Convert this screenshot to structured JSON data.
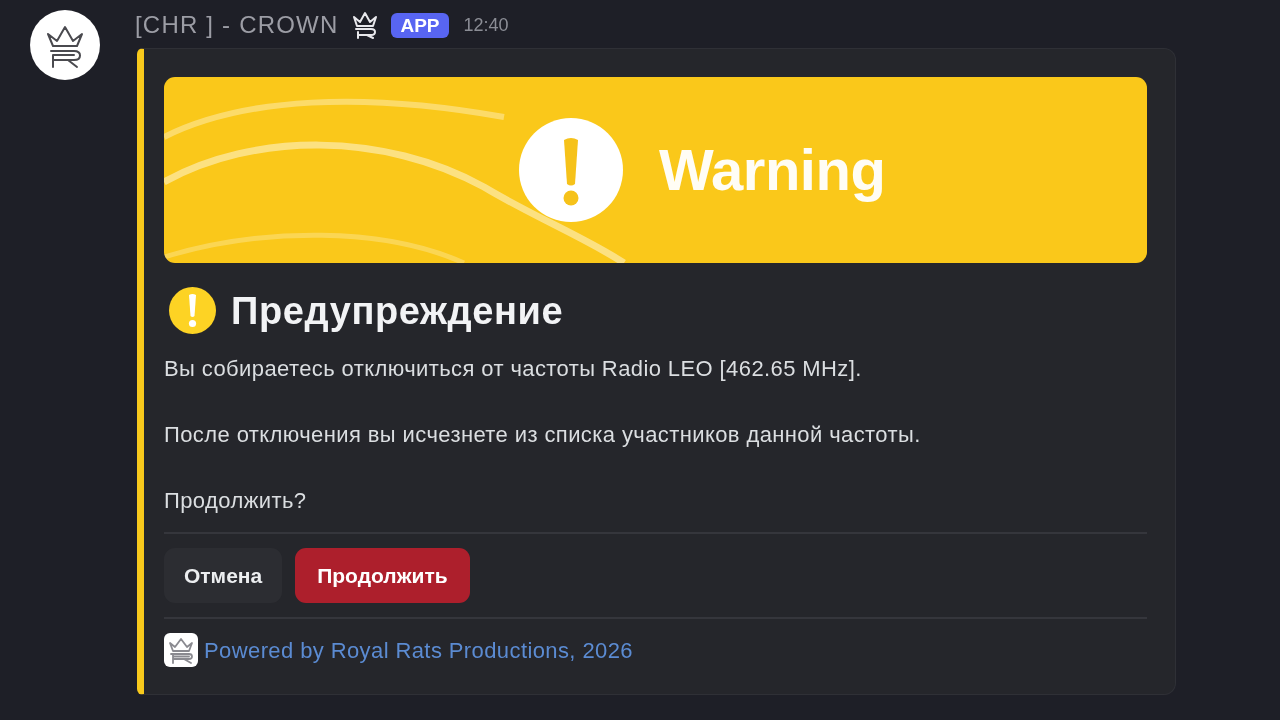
{
  "message": {
    "author": "[CHR ] - CROWN",
    "badge": "APP",
    "time": "12:40"
  },
  "embed": {
    "banner": {
      "title": "Warning"
    },
    "title": "Предупреждение",
    "paragraphs": [
      "Вы собираетесь отключиться от частоты Radio LEO [462.65 MHz].",
      "После отключения вы исчезнете из списка участников данной частоты.",
      "Продолжить?"
    ],
    "buttons": [
      {
        "label": "Отмена",
        "kind": "secondary"
      },
      {
        "label": "Продолжить",
        "kind": "danger"
      }
    ],
    "footer": "Powered by Royal Rats Productions, 2026"
  }
}
